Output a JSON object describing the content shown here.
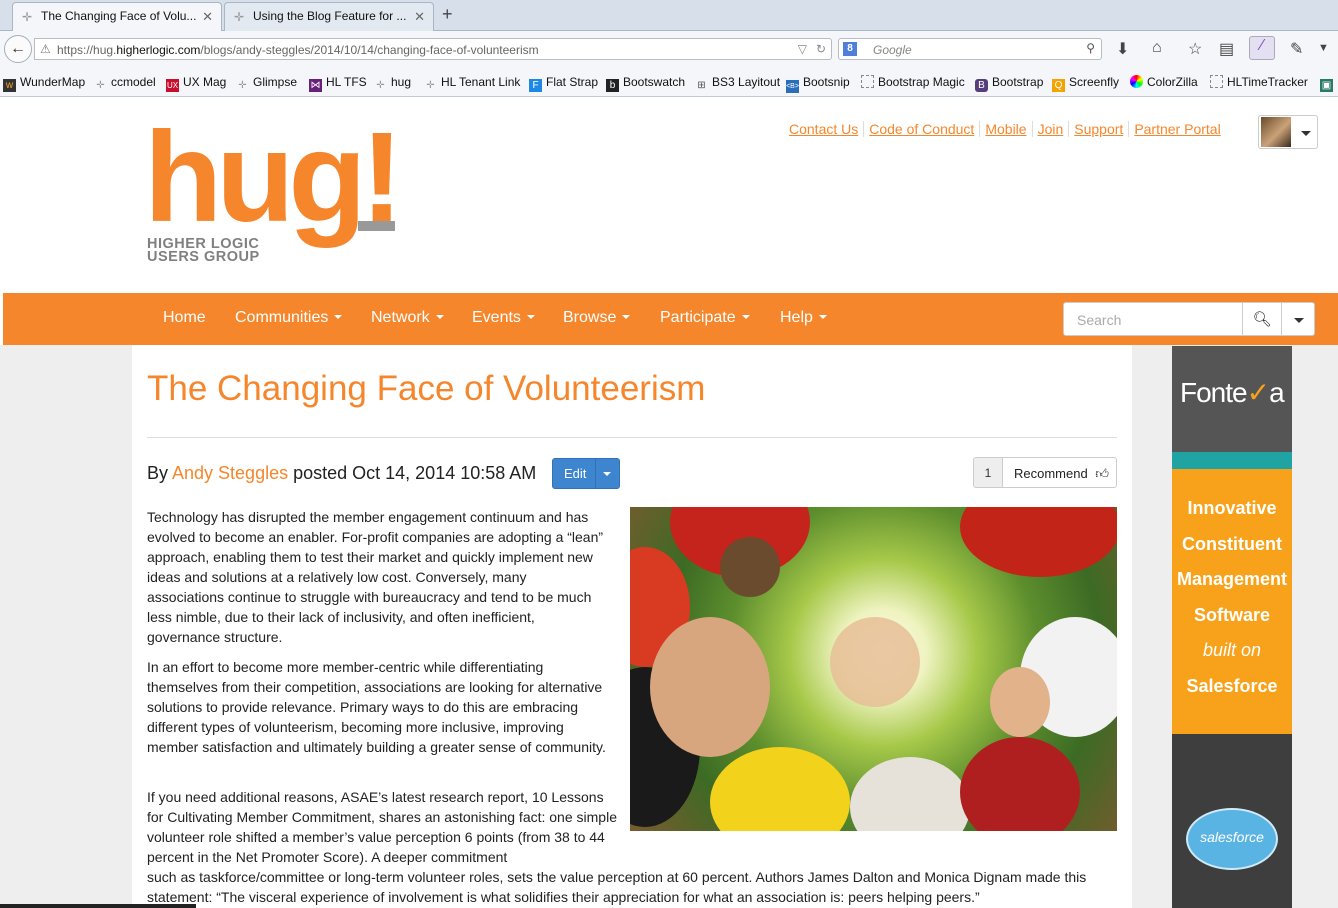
{
  "browser": {
    "tabs": [
      {
        "title": "The Changing Face of Volu..."
      },
      {
        "title": "Using the Blog Feature for ..."
      }
    ],
    "url_prefix": "https://hug.",
    "url_host": "higherlogic.com",
    "url_path": "/blogs/andy-steggles/2014/10/14/changing-face-of-volunteerism",
    "search_placeholder": "Google",
    "bookmarks": [
      "WunderMap",
      "ccmodel",
      "UX Mag",
      "Glimpse",
      "HL TFS",
      "hug",
      "HL Tenant Link",
      "Flat Strap",
      "Bootswatch",
      "BS3 Layitout",
      "Bootsnip",
      "Bootstrap Magic",
      "Bootstrap",
      "Screenfly",
      "ColorZilla",
      "HLTimeTracker"
    ]
  },
  "header": {
    "links": [
      "Contact Us",
      "Code of Conduct",
      "Mobile",
      "Join",
      "Support",
      "Partner Portal"
    ],
    "logo_text": "hug!",
    "logo_tagline_1": "HIGHER LOGIC",
    "logo_tagline_2": "USERS GROUP"
  },
  "nav": {
    "items": [
      "Home",
      "Communities",
      "Network",
      "Events",
      "Browse",
      "Participate",
      "Help"
    ],
    "search_placeholder": "Search"
  },
  "article": {
    "title": "The Changing Face of Volunteerism",
    "by": "By ",
    "author": "Andy Steggles",
    "posted": " posted Oct 14, 2014 10:58 AM",
    "edit_label": "Edit",
    "recommend_count": "1",
    "recommend_label": "Recommend",
    "p1": "Technology has disrupted the member engagement continuum and has evolved to become an enabler. For-profit companies are adopting a “lean” approach, enabling them to test their market and quickly implement new ideas and solutions at a relatively low cost. Conversely, many associations continue to struggle with bureaucracy and tend to be much less nimble, due to their lack of inclusivity, and often inefficient, governance structure.",
    "p2": "In an effort to become more member-centric while differentiating themselves from their competition, associations are looking for alternative solutions to provide relevance. Primary ways to do this are embracing different types of volunteerism, becoming more inclusive, improving member satisfaction and ultimately building a greater sense of community.",
    "p3a": "If you need additional reasons, ASAE’s latest research report, 10 Lessons for Cultivating Member Commitment, shares an astonishing fact: one simple volunteer role shifted a member’s value perception 6 points (from 38 to 44 percent in the Net Promoter Score). A deeper commitment",
    "p3b": "such as taskforce/committee or long-term volunteer roles, sets the value perception at 60 percent. Authors James Dalton and Monica Dignam made this statement: “The visceral experience of involvement is what solidifies their appreciation for what an association is: peers helping peers.”"
  },
  "ad": {
    "brand": "Fonte",
    "brand_mark": "✓",
    "brand_end": "a",
    "lines": [
      "Innovative",
      "Constituent",
      "Management",
      "Software"
    ],
    "line_italic": "built on",
    "line_last": "Salesforce",
    "badge": "salesforce"
  }
}
